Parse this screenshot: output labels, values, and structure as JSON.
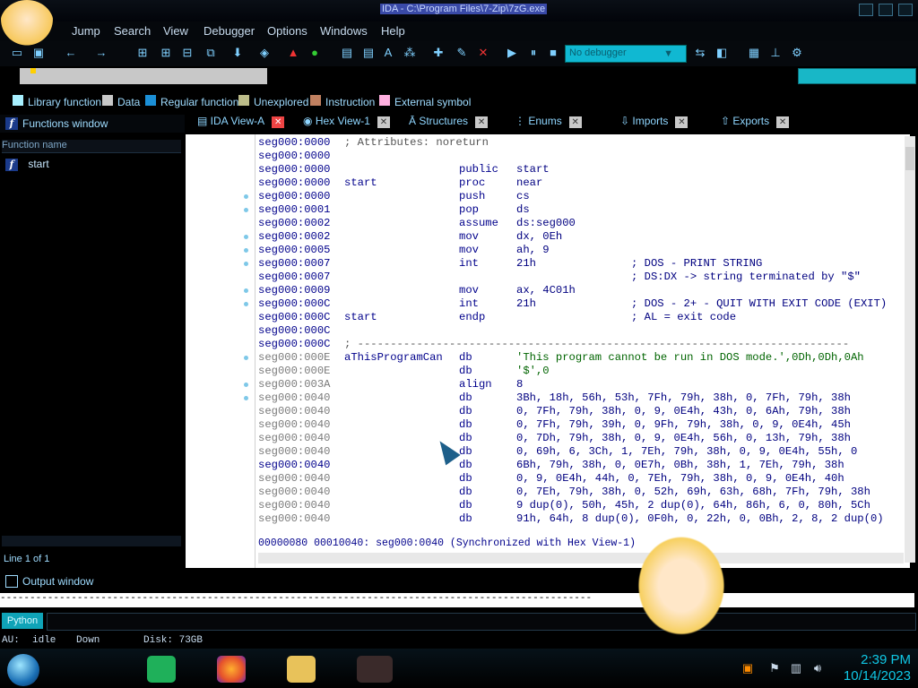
{
  "window": {
    "title": "IDA - C:\\Program Files\\7-Zip\\7zG.exe"
  },
  "menu": [
    "Jump",
    "Search",
    "View",
    "Debugger",
    "Options",
    "Windows",
    "Help"
  ],
  "toolbar": {
    "debugger_select": "No debugger"
  },
  "legend": [
    {
      "label": "Library function",
      "color": "#a8f0ff"
    },
    {
      "label": "Data",
      "color": "#c8c8c8"
    },
    {
      "label": "Regular function",
      "color": "#1b8fd6"
    },
    {
      "label": "Unexplored",
      "color": "#bdbd8a"
    },
    {
      "label": "Instruction",
      "color": "#c08060"
    },
    {
      "label": "External symbol",
      "color": "#ffb0e0"
    }
  ],
  "functions": {
    "title": "Functions window",
    "column": "Function name",
    "items": [
      "start"
    ],
    "status": "Line 1 of 1"
  },
  "tabs": [
    "IDA View-A",
    "Hex View-1",
    "Structures",
    "Enums",
    "Imports",
    "Exports"
  ],
  "disasm": [
    {
      "addr": "seg000:0000",
      "label": "",
      "mn": "",
      "ops": "",
      "cm": "; Attributes: noreturn",
      "raw": true
    },
    {
      "addr": "seg000:0000",
      "label": "",
      "mn": "",
      "ops": "",
      "cm": ""
    },
    {
      "addr": "seg000:0000",
      "label": "",
      "mn": "public",
      "ops": "start",
      "cm": ""
    },
    {
      "addr": "seg000:0000",
      "label": "start",
      "mn": "proc",
      "ops": "near",
      "cm": ""
    },
    {
      "addr": "seg000:0000",
      "label": "",
      "mn": "push",
      "ops": "cs",
      "cm": ""
    },
    {
      "addr": "seg000:0001",
      "label": "",
      "mn": "pop",
      "ops": "ds",
      "cm": ""
    },
    {
      "addr": "seg000:0002",
      "label": "",
      "mn": "assume",
      "ops": "ds:seg000",
      "cm": ""
    },
    {
      "addr": "seg000:0002",
      "label": "",
      "mn": "mov",
      "ops": "dx, 0Eh",
      "cm": ""
    },
    {
      "addr": "seg000:0005",
      "label": "",
      "mn": "mov",
      "ops": "ah, 9",
      "cm": ""
    },
    {
      "addr": "seg000:0007",
      "label": "",
      "mn": "int",
      "ops": "21h",
      "cm": "; DOS - PRINT STRING"
    },
    {
      "addr": "seg000:0007",
      "label": "",
      "mn": "",
      "ops": "",
      "cm": "; DS:DX -> string terminated by \"$\""
    },
    {
      "addr": "seg000:0009",
      "label": "",
      "mn": "mov",
      "ops": "ax, 4C01h",
      "cm": ""
    },
    {
      "addr": "seg000:000C",
      "label": "",
      "mn": "int",
      "ops": "21h",
      "cm": "; DOS - 2+ - QUIT WITH EXIT CODE (EXIT)"
    },
    {
      "addr": "seg000:000C",
      "label": "start",
      "mn": "endp",
      "ops": "",
      "cm": "; AL = exit code"
    },
    {
      "addr": "seg000:000C",
      "label": "",
      "mn": "",
      "ops": "",
      "cm": ""
    },
    {
      "addr": "seg000:000C",
      "label": "",
      "mn": "",
      "ops": "",
      "cm": "; ---------------------------------------------------------------------------",
      "raw": true
    },
    {
      "addr": "seg000:000E",
      "label": "aThisProgramCan",
      "mn": "db",
      "ops": "'This program cannot be run in DOS mode.',0Dh,0Dh,0Ah",
      "cm": "",
      "gray": true
    },
    {
      "addr": "seg000:000E",
      "label": "",
      "mn": "db",
      "ops": "'$',0",
      "cm": "",
      "gray": true
    },
    {
      "addr": "seg000:003A",
      "label": "",
      "mn": "align",
      "ops": "8",
      "cm": "",
      "gray": true
    },
    {
      "addr": "seg000:0040",
      "label": "",
      "mn": "db",
      "ops": "3Bh, 18h, 56h, 53h, 7Fh, 79h, 38h, 0, 7Fh, 79h, 38h",
      "cm": "",
      "gray": true
    },
    {
      "addr": "seg000:0040",
      "label": "",
      "mn": "db",
      "ops": "0, 7Fh, 79h, 38h, 0, 9, 0E4h, 43h, 0, 6Ah, 79h, 38h",
      "cm": "",
      "gray": true
    },
    {
      "addr": "seg000:0040",
      "label": "",
      "mn": "db",
      "ops": "0, 7Fh, 79h, 39h, 0, 9Fh, 79h, 38h, 0, 9, 0E4h, 45h",
      "cm": "",
      "gray": true
    },
    {
      "addr": "seg000:0040",
      "label": "",
      "mn": "db",
      "ops": "0, 7Dh, 79h, 38h, 0, 9, 0E4h, 56h, 0, 13h, 79h, 38h",
      "cm": "",
      "gray": true
    },
    {
      "addr": "seg000:0040",
      "label": "",
      "mn": "db",
      "ops": "0, 69h, 6, 3Ch, 1, 7Eh, 79h, 38h, 0, 9, 0E4h, 55h, 0",
      "cm": "",
      "gray": true
    },
    {
      "addr": "seg000:0040",
      "label": "",
      "mn": "db",
      "ops": "6Bh, 79h, 38h, 0, 0E7h, 0Bh, 38h, 1, 7Eh, 79h, 38h",
      "cm": ""
    },
    {
      "addr": "seg000:0040",
      "label": "",
      "mn": "db",
      "ops": "0, 9, 0E4h, 44h, 0, 7Eh, 79h, 38h, 0, 9, 0E4h, 40h",
      "cm": "",
      "gray": true
    },
    {
      "addr": "seg000:0040",
      "label": "",
      "mn": "db",
      "ops": "0, 7Eh, 79h, 38h, 0, 52h, 69h, 63h, 68h, 7Fh, 79h, 38h",
      "cm": "",
      "gray": true
    },
    {
      "addr": "seg000:0040",
      "label": "",
      "mn": "db",
      "ops": "9 dup(0), 50h, 45h, 2 dup(0), 64h, 86h, 6, 0, 80h, 5Ch",
      "cm": "",
      "gray": true
    },
    {
      "addr": "seg000:0040",
      "label": "",
      "mn": "db",
      "ops": "91h, 64h, 8 dup(0), 0F0h, 0, 22h, 0, 0Bh, 2, 8, 2 dup(0)",
      "cm": "",
      "gray": true
    }
  ],
  "sync_line": "00000080 00010040: seg000:0040 (Synchronized with Hex View-1)",
  "output": {
    "title": "Output window",
    "line": "----------------------------------------------------------------------------------------------------"
  },
  "python_button": "Python",
  "status": {
    "au": "AU:",
    "state": "idle",
    "direction": "Down",
    "disk": "Disk: 73GB"
  },
  "clock": {
    "time": "2:39 PM",
    "date": "10/14/2023"
  }
}
